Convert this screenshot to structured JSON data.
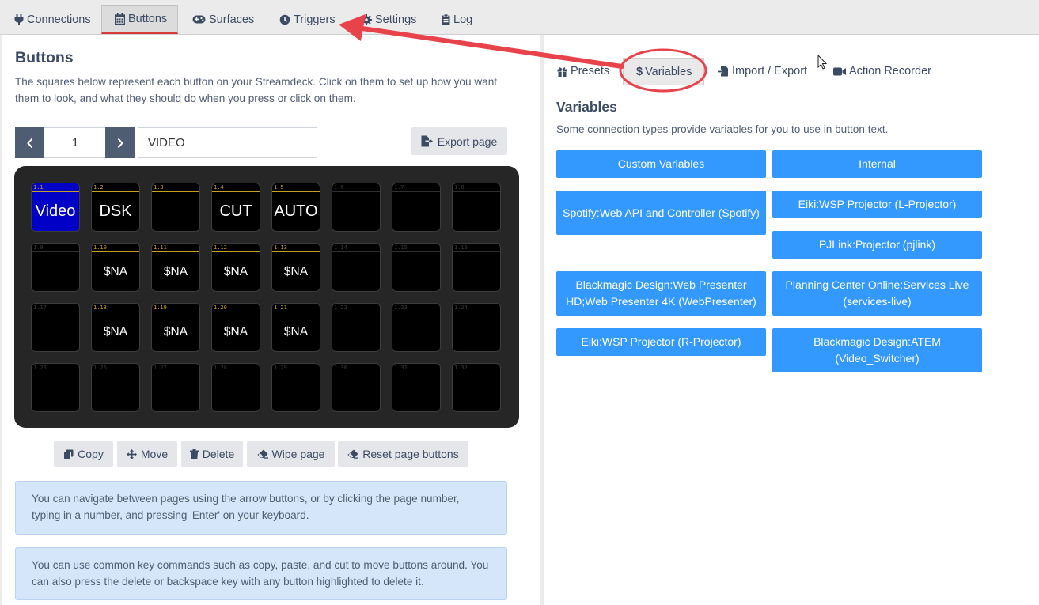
{
  "nav": {
    "tabs": [
      {
        "label": "Connections",
        "icon": "plug-icon"
      },
      {
        "label": "Buttons",
        "icon": "calendar-grid-icon",
        "active": true
      },
      {
        "label": "Surfaces",
        "icon": "gamepad-icon"
      },
      {
        "label": "Triggers",
        "icon": "clock-icon"
      },
      {
        "label": "Settings",
        "icon": "gear-icon"
      },
      {
        "label": "Log",
        "icon": "clipboard-icon"
      }
    ]
  },
  "buttons_panel": {
    "title": "Buttons",
    "description": "The squares below represent each button on your Streamdeck. Click on them to set up how you want them to look, and what they should do when you press or click on them.",
    "page_number": "1",
    "page_name": "VIDEO",
    "export_label": "Export page",
    "keys": [
      {
        "id": "1.1",
        "text": "Video",
        "style": "blue"
      },
      {
        "id": "1.2",
        "text": "DSK"
      },
      {
        "id": "1.3",
        "text": ""
      },
      {
        "id": "1.4",
        "text": "CUT"
      },
      {
        "id": "1.5",
        "text": "AUTO"
      },
      {
        "id": "1.6"
      },
      {
        "id": "1.7"
      },
      {
        "id": "1.8"
      },
      {
        "id": "1.9"
      },
      {
        "id": "1.10",
        "text": "$NA"
      },
      {
        "id": "1.11",
        "text": "$NA"
      },
      {
        "id": "1.12",
        "text": "$NA"
      },
      {
        "id": "1.13",
        "text": "$NA"
      },
      {
        "id": "1.14"
      },
      {
        "id": "1.15"
      },
      {
        "id": "1.16"
      },
      {
        "id": "1.17"
      },
      {
        "id": "1.18",
        "text": "$NA"
      },
      {
        "id": "1.19",
        "text": "$NA"
      },
      {
        "id": "1.20",
        "text": "$NA"
      },
      {
        "id": "1.21",
        "text": "$NA"
      },
      {
        "id": "1.22"
      },
      {
        "id": "1.23"
      },
      {
        "id": "1.24"
      },
      {
        "id": "1.25"
      },
      {
        "id": "1.26"
      },
      {
        "id": "1.27"
      },
      {
        "id": "1.28"
      },
      {
        "id": "1.29"
      },
      {
        "id": "1.30"
      },
      {
        "id": "1.31"
      },
      {
        "id": "1.32"
      }
    ],
    "actions": {
      "copy": "Copy",
      "move": "Move",
      "delete": "Delete",
      "wipe": "Wipe page",
      "reset": "Reset page buttons"
    },
    "info1": "You can navigate between pages using the arrow buttons, or by clicking the page number, typing in a number, and pressing 'Enter' on your keyboard.",
    "info2": "You can use common key commands such as copy, paste, and cut to move buttons around. You can also press the delete or backspace key with any button highlighted to delete it."
  },
  "right_panel": {
    "tabs": {
      "presets": "Presets",
      "variables": "Variables",
      "import_export": "Import / Export",
      "action_recorder": "Action Recorder"
    },
    "title": "Variables",
    "description": "Some connection types provide variables for you to use in button text.",
    "variable_buttons": [
      "Custom Variables",
      "Internal",
      "Spotify:Web API and Controller (Spotify)",
      "Eiki:WSP Projector (L-Projector)",
      "PJLink:Projector (pjlink)",
      "Blackmagic Design:Web Presenter HD;Web Presenter 4K (WebPresenter)",
      "Planning Center Online:Services Live (services-live)",
      "Eiki:WSP Projector (R-Projector)",
      "Blackmagic Design:ATEM (Video_Switcher)"
    ]
  },
  "colors": {
    "accent_red": "#e8434a",
    "variable_button": "#3399ff",
    "pager": "#4f5d73",
    "info_bg": "#d5e6fb",
    "key_used_label": "#c8a020",
    "key_blue": "#0000c6"
  }
}
